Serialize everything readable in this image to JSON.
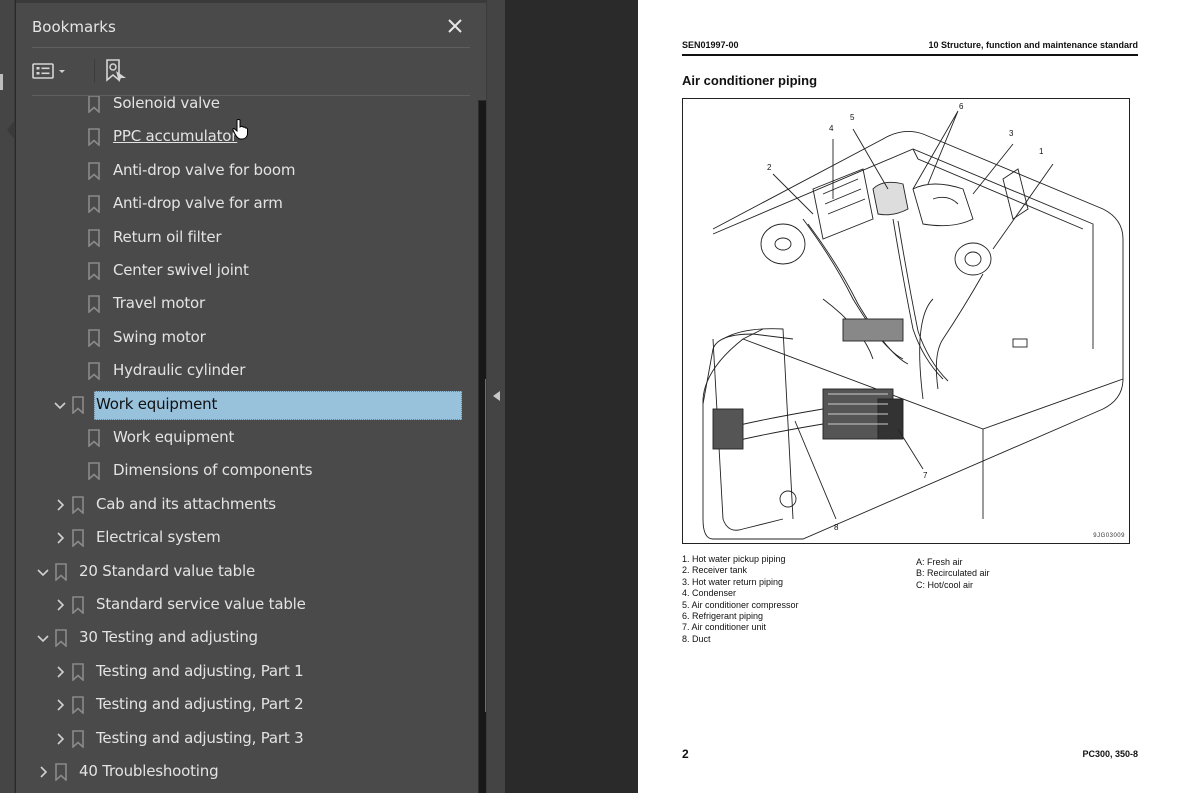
{
  "panel": {
    "title": "Bookmarks",
    "close_icon": "close-icon",
    "toolbar": {
      "options_icon": "list-options-icon",
      "dropdown_icon": "caret-down-icon",
      "find_bookmark_icon": "bookmark-find-icon"
    }
  },
  "bookmarks": [
    {
      "label": "Solenoid valve",
      "level": 3,
      "expander": "none"
    },
    {
      "label": "PPC accumulator",
      "level": 3,
      "expander": "none",
      "hovered": true
    },
    {
      "label": "Anti-drop valve for boom",
      "level": 3,
      "expander": "none"
    },
    {
      "label": "Anti-drop valve for arm",
      "level": 3,
      "expander": "none"
    },
    {
      "label": "Return oil filter",
      "level": 3,
      "expander": "none"
    },
    {
      "label": "Center swivel joint",
      "level": 3,
      "expander": "none"
    },
    {
      "label": "Travel motor",
      "level": 3,
      "expander": "none"
    },
    {
      "label": "Swing motor",
      "level": 3,
      "expander": "none"
    },
    {
      "label": "Hydraulic cylinder",
      "level": 3,
      "expander": "none"
    },
    {
      "label": "Work equipment",
      "level": 2,
      "expander": "expanded",
      "selected": true
    },
    {
      "label": "Work equipment",
      "level": 3,
      "expander": "none"
    },
    {
      "label": "Dimensions of components",
      "level": 3,
      "expander": "none"
    },
    {
      "label": "Cab and its attachments",
      "level": 2,
      "expander": "collapsed"
    },
    {
      "label": "Electrical system",
      "level": 2,
      "expander": "collapsed"
    },
    {
      "label": "20 Standard value table",
      "level": 1,
      "expander": "expanded"
    },
    {
      "label": "Standard service value table",
      "level": 2,
      "expander": "collapsed"
    },
    {
      "label": "30 Testing and adjusting",
      "level": 1,
      "expander": "expanded"
    },
    {
      "label": "Testing and adjusting, Part 1",
      "level": 2,
      "expander": "collapsed"
    },
    {
      "label": "Testing and adjusting, Part 2",
      "level": 2,
      "expander": "collapsed"
    },
    {
      "label": "Testing and adjusting, Part 3",
      "level": 2,
      "expander": "collapsed"
    },
    {
      "label": "40 Troubleshooting",
      "level": 1,
      "expander": "collapsed"
    }
  ],
  "scrollbar": {
    "thumb_start": 0.4,
    "thumb_end": 0.88
  },
  "page": {
    "doc_id": "SEN01997-00",
    "section": "10 Structure, function and maintenance standard",
    "title": "Air conditioner piping",
    "figure_code": "9JG03009",
    "callouts": [
      "1",
      "2",
      "3",
      "4",
      "5",
      "6",
      "7",
      "8"
    ],
    "legend_numbered": [
      "1. Hot water pickup piping",
      "2. Receiver tank",
      "3. Hot water return piping",
      "4. Condenser",
      "5. Air conditioner compressor",
      "6. Refrigerant piping",
      "7. Air conditioner unit",
      "8. Duct"
    ],
    "legend_lettered": [
      "A: Fresh air",
      "B: Recirculated air",
      "C: Hot/cool air"
    ],
    "page_number": "2",
    "model": "PC300, 350-8"
  },
  "colors": {
    "panel_bg": "#4a4a4a",
    "selection": "#98c1dc",
    "doc_bg": "#2a2a2a"
  }
}
